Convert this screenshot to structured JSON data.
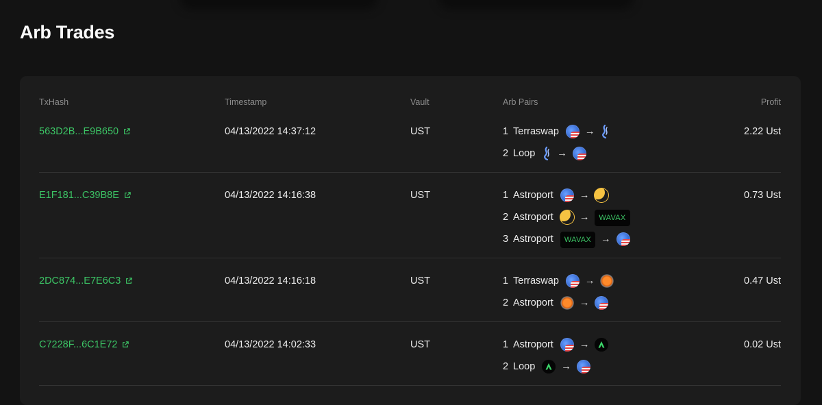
{
  "page": {
    "title": "Arb Trades"
  },
  "table": {
    "headers": {
      "txhash": "TxHash",
      "timestamp": "Timestamp",
      "vault": "Vault",
      "arb_pairs": "Arb Pairs",
      "profit": "Profit"
    },
    "rows": [
      {
        "txhash": "563D2B...E9B650",
        "timestamp": "04/13/2022 14:37:12",
        "vault": "UST",
        "profit": "2.22 Ust",
        "steps": [
          {
            "num": "1",
            "dex": "Terraswap",
            "arrow": "→"
          },
          {
            "num": "2",
            "dex": "Loop",
            "arrow": "→"
          }
        ]
      },
      {
        "txhash": "E1F181...C39B8E",
        "timestamp": "04/13/2022 14:16:38",
        "vault": "UST",
        "profit": "0.73 Ust",
        "steps": [
          {
            "num": "1",
            "dex": "Astroport",
            "arrow": "→"
          },
          {
            "num": "2",
            "dex": "Astroport",
            "arrow": "→",
            "badge": "WAVAX"
          },
          {
            "num": "3",
            "dex": "Astroport",
            "arrow": "→",
            "badge": "WAVAX"
          }
        ]
      },
      {
        "txhash": "2DC874...E7E6C3",
        "timestamp": "04/13/2022 14:16:18",
        "vault": "UST",
        "profit": "0.47 Ust",
        "steps": [
          {
            "num": "1",
            "dex": "Terraswap",
            "arrow": "→"
          },
          {
            "num": "2",
            "dex": "Astroport",
            "arrow": "→"
          }
        ]
      },
      {
        "txhash": "C7228F...6C1E72",
        "timestamp": "04/13/2022 14:02:33",
        "vault": "UST",
        "profit": "0.02 Ust",
        "steps": [
          {
            "num": "1",
            "dex": "Astroport",
            "arrow": "→"
          },
          {
            "num": "2",
            "dex": "Loop",
            "arrow": "→"
          }
        ]
      }
    ]
  },
  "icons": {
    "external_link": "external-link-icon",
    "ust_token": "ust-token-icon",
    "wave_token": "wave-token-icon",
    "luna_token": "luna-token-icon",
    "orb_token": "orange-orb-token-icon",
    "green_token": "green-arrow-token-icon"
  },
  "colors": {
    "background": "#131313",
    "card": "#1c1c1c",
    "hash_link": "#3cc465",
    "header_text": "#8c8c8c",
    "divider": "#333333"
  }
}
